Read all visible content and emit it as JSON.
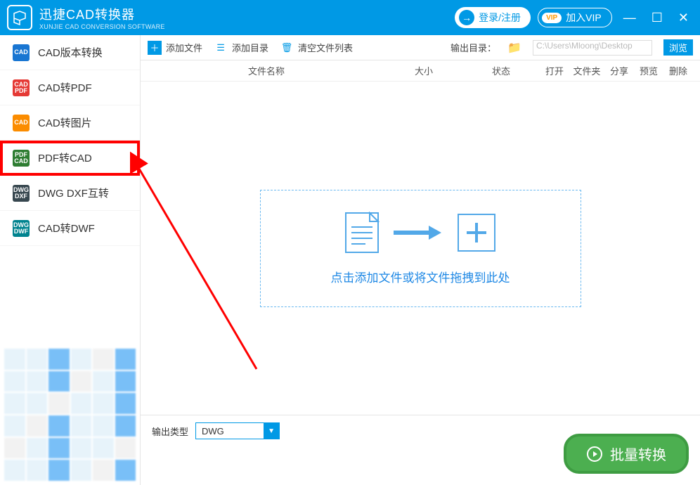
{
  "titlebar": {
    "logo_text": "CAD",
    "title": "迅捷CAD转换器",
    "subtitle": "XUNJIE CAD CONVERSION SOFTWARE",
    "login_label": "登录/注册",
    "vip_badge": "VIP",
    "vip_label": "加入VIP"
  },
  "sidebar": {
    "items": [
      {
        "label": "CAD版本转换",
        "color": "#1976d2"
      },
      {
        "label": "CAD转PDF",
        "color": "#e53935"
      },
      {
        "label": "CAD转图片",
        "color": "#fb8c00"
      },
      {
        "label": "PDF转CAD",
        "color": "#2e7d32"
      },
      {
        "label": "DWG DXF互转",
        "color": "#37474f"
      },
      {
        "label": "CAD转DWF",
        "color": "#00838f"
      }
    ],
    "selected_index": 3
  },
  "toolbar": {
    "add_file": "添加文件",
    "add_dir": "添加目录",
    "clear_list": "清空文件列表",
    "outdir_label": "输出目录：",
    "outdir_path": "C:\\Users\\Mloong\\Desktop",
    "browse": "浏览"
  },
  "list_header": {
    "name": "文件名称",
    "size": "大小",
    "status": "状态",
    "open": "打开",
    "folder": "文件夹",
    "share": "分享",
    "preview": "预览",
    "delete": "删除"
  },
  "drop": {
    "hint": "点击添加文件或将文件拖拽到此处"
  },
  "bottom": {
    "outtype_label": "输出类型",
    "outtype_value": "DWG",
    "convert": "批量转换"
  }
}
